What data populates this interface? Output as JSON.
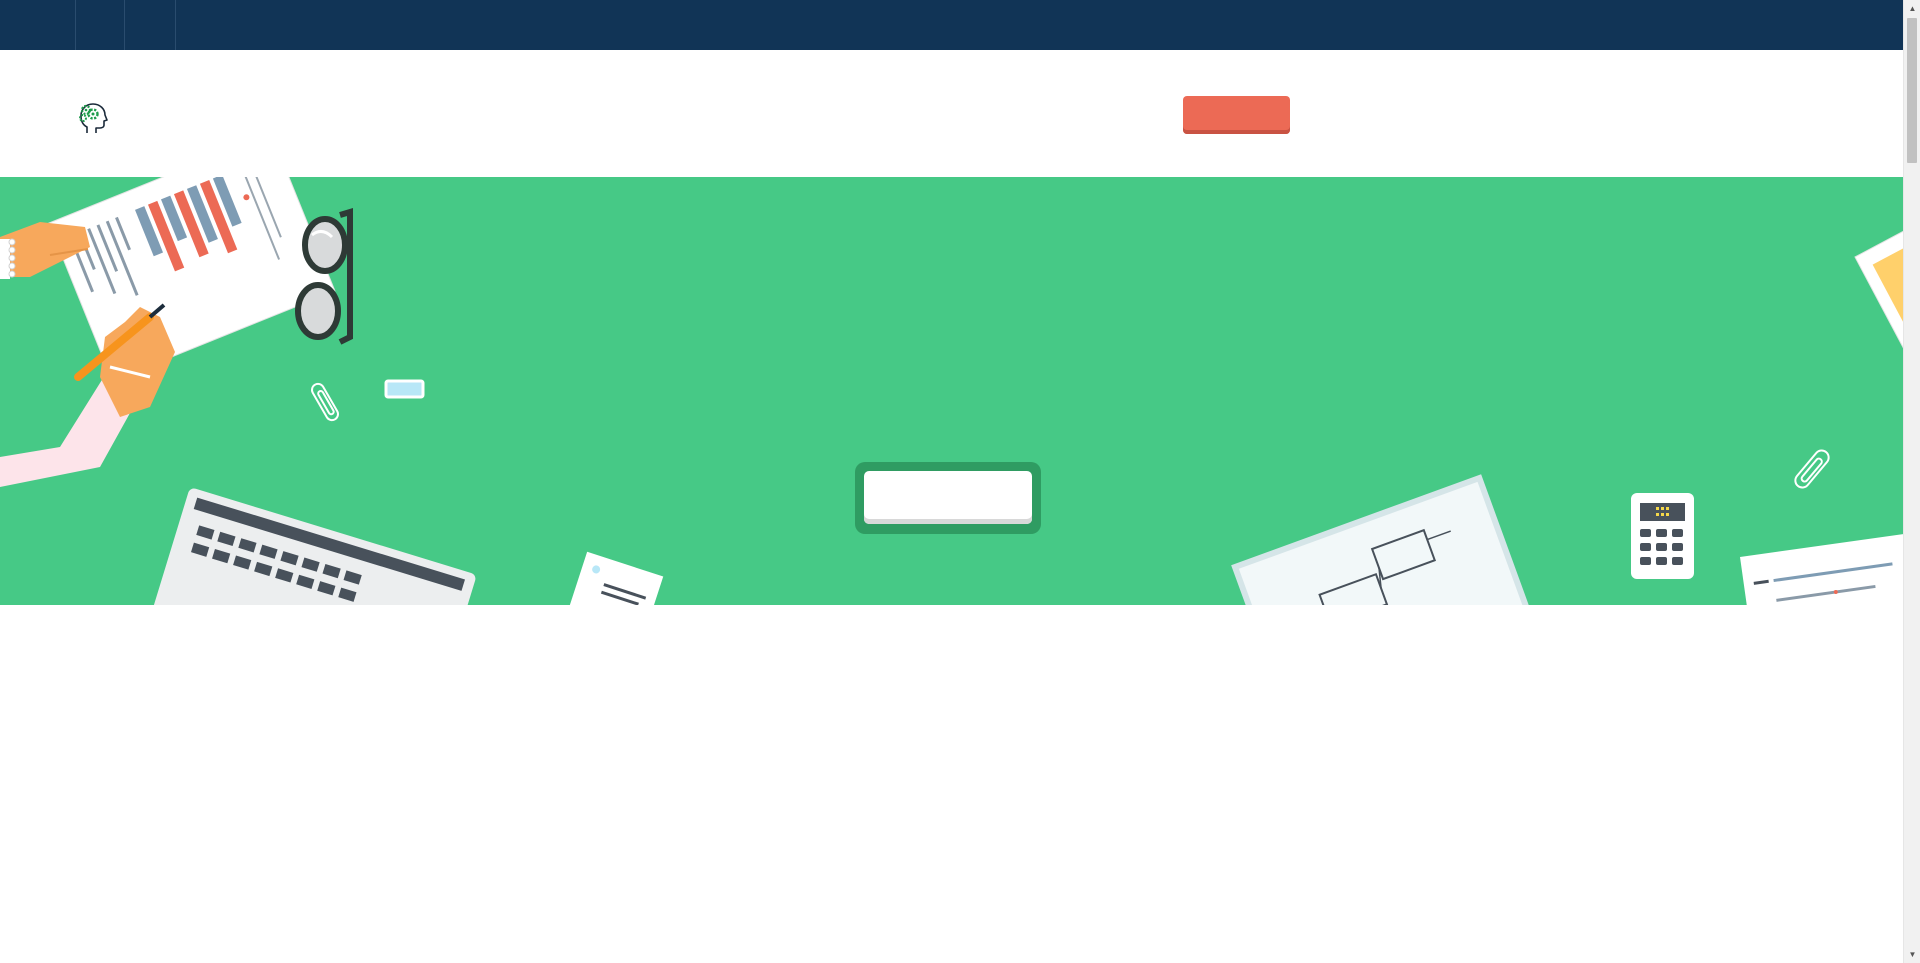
{
  "topbar": {
    "items": [
      "",
      "",
      ""
    ]
  },
  "header": {
    "logo_icon": "head-gears-icon",
    "cta_label": ""
  },
  "hero": {
    "button_label": ""
  },
  "colors": {
    "topbar": "#113456",
    "hero_bg": "#46c986",
    "cta": "#ec6a55",
    "hero_button_frame": "#2f9c62"
  },
  "scrollbar": {
    "up_icon": "arrow-up-icon",
    "down_icon": "arrow-down-icon"
  }
}
